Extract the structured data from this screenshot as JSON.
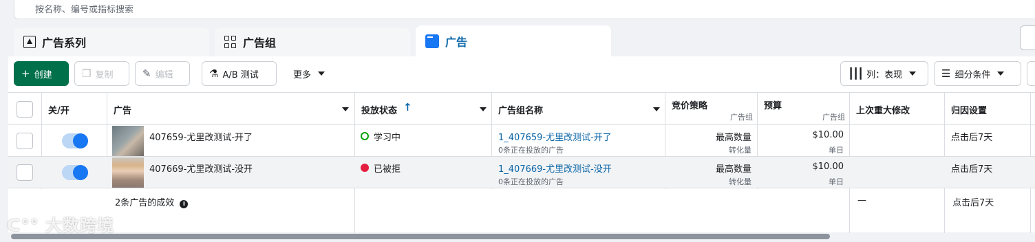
{
  "search": {
    "placeholder": "按名称、编号或指标搜索"
  },
  "tabs": [
    {
      "label": "广告系列",
      "icon": "campaign-icon"
    },
    {
      "label": "广告组",
      "icon": "ad-set-icon"
    },
    {
      "label": "广告",
      "icon": "ad-icon",
      "active": true
    }
  ],
  "toolbar": {
    "create": "创建",
    "duplicate": "复制",
    "edit": "编辑",
    "ab_test": "A/B 测试",
    "more": "更多",
    "columns": "列：表现",
    "breakdown": "细分条件"
  },
  "table": {
    "headers": {
      "on_off": "关/开",
      "ad": "广告",
      "delivery": "投放状态",
      "delivery_sort": "↑",
      "adset_name": "广告组名称",
      "bid_strategy": "竞价策略",
      "bid_strategy_sub": "广告组",
      "budget": "预算",
      "budget_sub": "广告组",
      "last_edit": "上次重大修改",
      "attribution": "归因设置"
    },
    "rows": [
      {
        "ad_name": "407659-尤里改测试-开了",
        "status": "学习中",
        "status_color": "#00a400",
        "adset": "1_407659-尤里改测试-开了",
        "adset_sub": "0条正在投放的广告",
        "bid": "最高数量",
        "bid_sub": "转化量",
        "budget": "$10.00",
        "budget_sub": "单日",
        "attribution": "点击后7天"
      },
      {
        "ad_name": "407669-尤里改测试-没开",
        "status": "已被拒",
        "status_color": "#e41e3f",
        "adset": "1_407669-尤里改测试-没开",
        "adset_sub": "0条正在投放的广告",
        "bid": "最高数量",
        "bid_sub": "转化量",
        "budget": "$10.00",
        "budget_sub": "单日",
        "attribution": "点击后7天"
      }
    ],
    "summary": {
      "label": "2条广告的成效",
      "last_edit": "—",
      "attribution": "点击后7天"
    }
  },
  "watermark": "大数跨境"
}
